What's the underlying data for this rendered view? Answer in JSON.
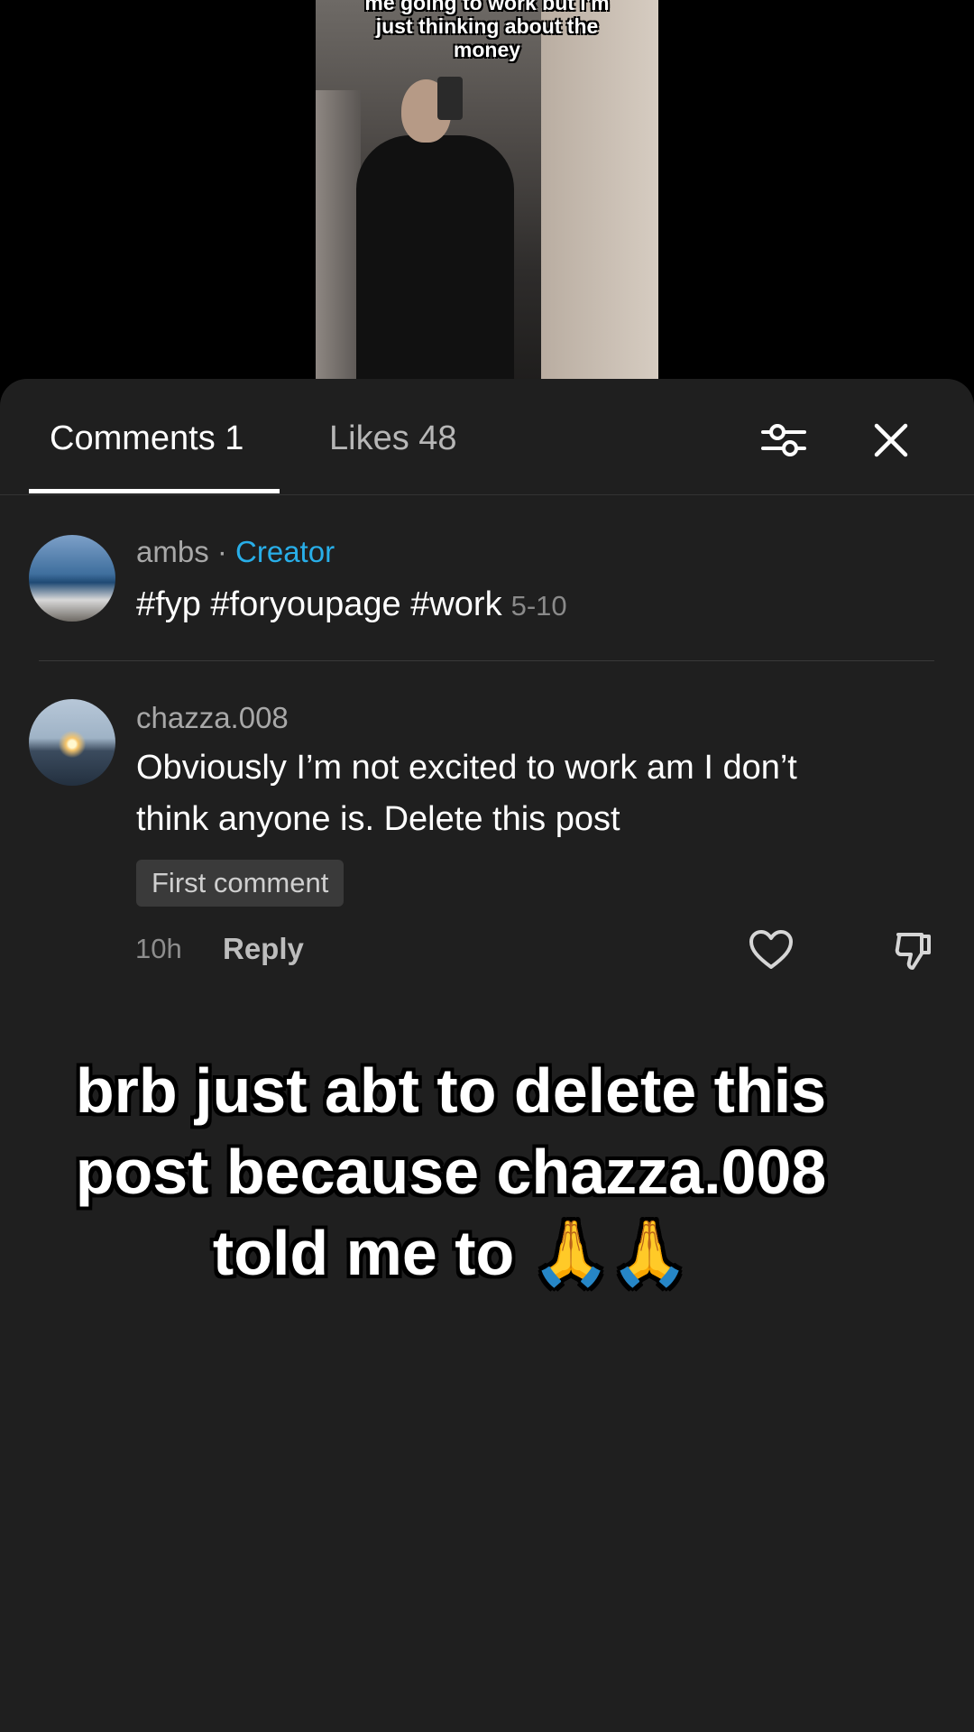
{
  "video": {
    "caption_lines": [
      "me going to work but i'm",
      "just thinking about the",
      "money"
    ]
  },
  "tabs": {
    "comments_label": "Comments 1",
    "likes_label": "Likes 48",
    "filter_icon": "filter-sliders-icon",
    "close_icon": "close-icon"
  },
  "comments": [
    {
      "username": "ambs",
      "separator": " · ",
      "role": "Creator",
      "text": "#fyp #foryoupage #work",
      "date": "5-10"
    },
    {
      "username": "chazza.008",
      "text_lines": [
        "Obviously I’m not excited to work am I don’t",
        "think anyone is. Delete this post"
      ],
      "badge": "First comment",
      "time": "10h",
      "reply_label": "Reply",
      "like_icon": "heart-icon",
      "dislike_icon": "dislike-icon"
    }
  ],
  "overlay": {
    "lines": [
      "brb just abt to delete this",
      "post because chazza.008",
      "told me to 🙏🙏"
    ]
  },
  "colors": {
    "sheet_bg": "#1f1f1f",
    "creator_accent": "#28aee8"
  }
}
